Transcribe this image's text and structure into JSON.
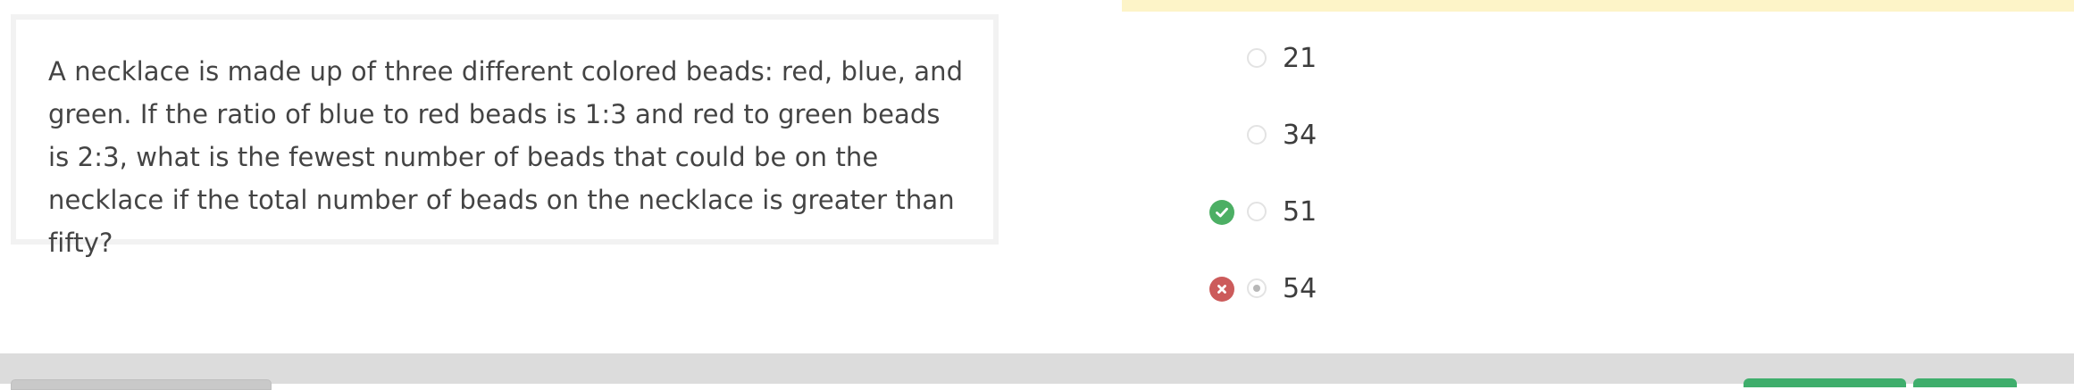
{
  "question": {
    "text": "A necklace is made up of three different colored beads: red, blue, and green. If the ratio of blue to red beads is 1:3 and red to green beads is 2:3, what is the fewest number of beads that could be on the necklace if the total number of beads on the necklace is greater than fifty?"
  },
  "choices": [
    {
      "label": "21",
      "selected": false,
      "mark": "none"
    },
    {
      "label": "34",
      "selected": false,
      "mark": "none"
    },
    {
      "label": "51",
      "selected": false,
      "mark": "correct"
    },
    {
      "label": "54",
      "selected": true,
      "mark": "incorrect"
    }
  ],
  "icons": {
    "correct": "check-circle-icon",
    "incorrect": "x-circle-icon"
  },
  "colors": {
    "correct": "#4caf64",
    "incorrect": "#cc5b5b",
    "banner": "#fdf4c8",
    "footer": "#dcdcdc",
    "footer_button_green": "#3fae6c"
  }
}
